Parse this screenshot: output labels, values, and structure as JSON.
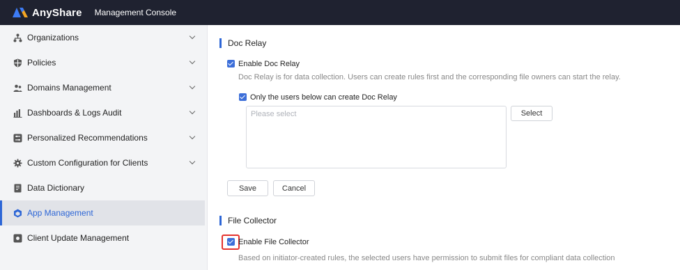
{
  "header": {
    "brand": "AnyShare",
    "console_title": "Management Console"
  },
  "sidebar": {
    "items": [
      {
        "label": "Organizations",
        "icon": "org-icon",
        "expandable": true
      },
      {
        "label": "Policies",
        "icon": "policy-icon",
        "expandable": true
      },
      {
        "label": "Domains Management",
        "icon": "users-icon",
        "expandable": true
      },
      {
        "label": "Dashboards & Logs Audit",
        "icon": "bar-chart-icon",
        "expandable": true
      },
      {
        "label": "Personalized Recommendations",
        "icon": "sliders-icon",
        "expandable": true
      },
      {
        "label": "Custom Configuration for Clients",
        "icon": "gear-icon",
        "expandable": true
      },
      {
        "label": "Data Dictionary",
        "icon": "book-icon",
        "expandable": false
      },
      {
        "label": "App Management",
        "icon": "cube-icon",
        "expandable": false,
        "active": true
      },
      {
        "label": "Client Update Management",
        "icon": "update-icon",
        "expandable": false
      }
    ]
  },
  "doc_relay": {
    "title": "Doc Relay",
    "enable_label": "Enable Doc Relay",
    "enable_checked": true,
    "description": "Doc Relay is for data collection. Users can create rules first and the corresponding file owners can start the relay.",
    "restrict_label": "Only the users below can create Doc Relay",
    "restrict_checked": true,
    "users_placeholder": "Please select",
    "select_button": "Select",
    "save_button": "Save",
    "cancel_button": "Cancel"
  },
  "file_collector": {
    "title": "File Collector",
    "enable_label": "Enable File Collector",
    "enable_checked": true,
    "description": "Based on initiator-created rules, the selected users have permission to submit files for compliant data collection"
  },
  "colors": {
    "topbar": "#1f2230",
    "accent": "#2d66d6",
    "highlight": "#e5322d"
  }
}
